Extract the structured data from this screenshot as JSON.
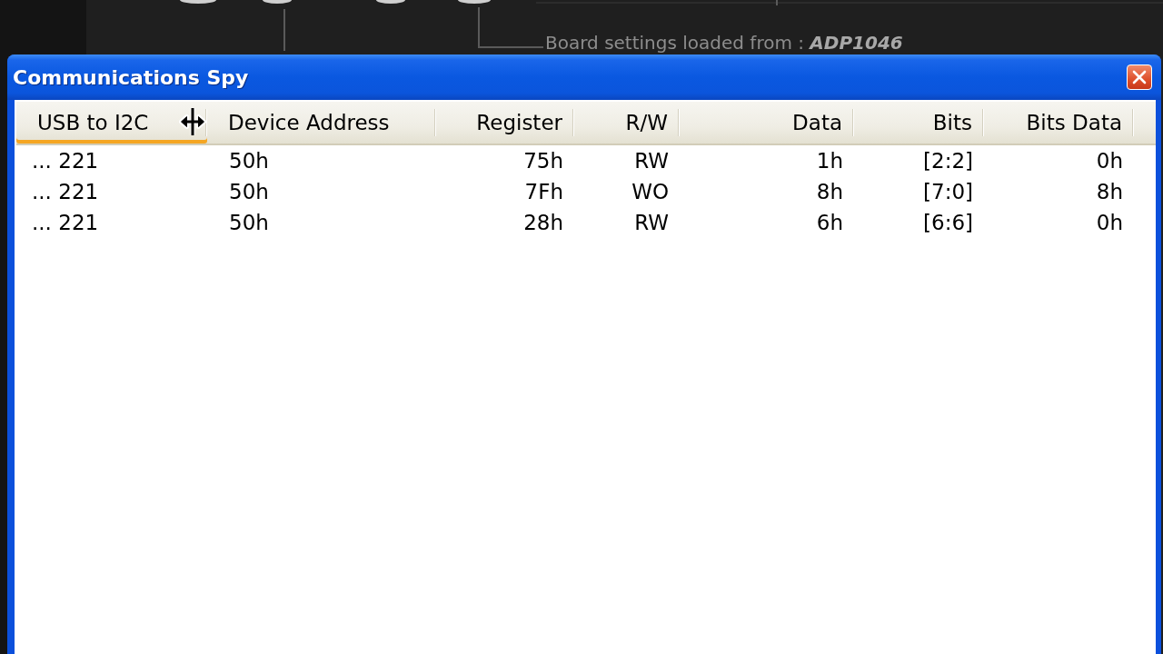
{
  "background_app": {
    "status_text": "Board settings loaded from : **ADP1046**"
  },
  "window": {
    "title": "Communications Spy",
    "list": {
      "columns": [
        {
          "label": "USB to I2C",
          "highlighted": true
        },
        {
          "label": "Device Address",
          "highlighted": false
        },
        {
          "label": "Register",
          "highlighted": false
        },
        {
          "label": "R/W",
          "highlighted": false
        },
        {
          "label": "Data",
          "highlighted": false
        },
        {
          "label": "Bits",
          "highlighted": false
        },
        {
          "label": "Bits Data",
          "highlighted": false
        }
      ],
      "rows": [
        [
          "... 221",
          "50h",
          "75h",
          "RW",
          "1h",
          "[2:2]",
          "0h"
        ],
        [
          "... 221",
          "50h",
          "7Fh",
          "WO",
          "8h",
          "[7:0]",
          "8h"
        ],
        [
          "... 221",
          "50h",
          "28h",
          "RW",
          "6h",
          "[6:6]",
          "0h"
        ]
      ]
    }
  }
}
